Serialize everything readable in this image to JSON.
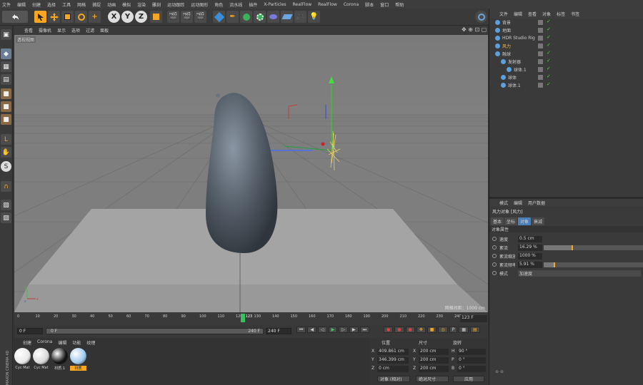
{
  "menubar": [
    "文件",
    "编辑",
    "创建",
    "选择",
    "工具",
    "网格",
    "捕捉",
    "动画",
    "模拟",
    "渲染",
    "雕刻",
    "运动跟踪",
    "运动图形",
    "角色",
    "流水线",
    "插件",
    "X-Particles",
    "RealFlow",
    "RealFlow",
    "Corona",
    "脚本",
    "窗口",
    "帮助"
  ],
  "viewport": {
    "menu": [
      "查看",
      "摄像机",
      "显示",
      "选项",
      "过滤",
      "面板"
    ],
    "label": "透视视图",
    "grid_info": "网格间距：1000 cm"
  },
  "timeline": {
    "ticks": [
      "0",
      "10",
      "20",
      "30",
      "40",
      "50",
      "60",
      "70",
      "80",
      "90",
      "100",
      "110",
      "120",
      "130",
      "140",
      "150",
      "160",
      "170",
      "180",
      "190",
      "200",
      "210",
      "220",
      "230",
      "240"
    ],
    "current_frame": "123",
    "frame_badge": "123 F"
  },
  "transport": {
    "start": "0 F",
    "range_start": "0 F",
    "range_end": "240 F",
    "end": "240 F"
  },
  "materials": {
    "tabs": [
      "创建",
      "Corona",
      "编辑",
      "功能",
      "纹理"
    ],
    "items": [
      {
        "label": "Cyc Mat",
        "color": "#e8e8e8"
      },
      {
        "label": "Cyc Mat",
        "color": "#d8d8d8"
      },
      {
        "label": "材质.1",
        "color": "#111111"
      },
      {
        "label": "材质",
        "color": "#9fc8ef"
      }
    ],
    "logo_text": "MAXON CINEMA 4D"
  },
  "coords": {
    "headers": [
      "位置",
      "尺寸",
      "旋转"
    ],
    "rows": [
      {
        "axis": "X",
        "pos": "409.861 cm",
        "size_axis": "X",
        "size": "200 cm",
        "rot_axis": "H",
        "rot": "90 °"
      },
      {
        "axis": "Y",
        "pos": "346.399 cm",
        "size_axis": "Y",
        "size": "200 cm",
        "rot_axis": "P",
        "rot": "0 °"
      },
      {
        "axis": "Z",
        "pos": "0 cm",
        "size_axis": "Z",
        "size": "200 cm",
        "rot_axis": "B",
        "rot": "0 °"
      }
    ],
    "mode_select": "对象 (相对)",
    "size_select": "绝对尺寸",
    "apply_button": "应用"
  },
  "object_manager": {
    "menu": [
      "文件",
      "编辑",
      "查看",
      "对象",
      "标签",
      "书签"
    ],
    "objects": [
      {
        "name": "背景",
        "indent": 0,
        "color": "#cccccc"
      },
      {
        "name": "地面",
        "indent": 0,
        "color": "#cccccc"
      },
      {
        "name": "HDR Studio Rig",
        "indent": 0,
        "color": "#cccccc"
      },
      {
        "name": "风力",
        "indent": 0,
        "color": "#f0c040"
      },
      {
        "name": "融球",
        "indent": 0,
        "color": "#cccccc"
      },
      {
        "name": "发射器",
        "indent": 1,
        "color": "#cccccc"
      },
      {
        "name": "球体.1",
        "indent": 2,
        "color": "#cccccc"
      },
      {
        "name": "球体",
        "indent": 1,
        "color": "#cccccc"
      },
      {
        "name": "球体.1",
        "indent": 1,
        "color": "#cccccc"
      }
    ]
  },
  "attribute_manager": {
    "menu": [
      "模式",
      "编辑",
      "用户数据"
    ],
    "title": "风力对象 [风力]",
    "tabs": [
      "基本",
      "坐标",
      "对象",
      "衰减"
    ],
    "section": "对象属性",
    "properties": [
      {
        "label": "速度",
        "value": "0.5 cm",
        "slider": null
      },
      {
        "label": "紊流",
        "value": "16.29 %",
        "slider": 0.1629
      },
      {
        "label": "紊流缩放",
        "value": "1000 %",
        "slider": null
      },
      {
        "label": "紊流频率",
        "value": "5.91 %",
        "slider": 0.0591
      },
      {
        "label": "模式",
        "value": "加速度",
        "slider": null
      }
    ]
  },
  "colors": {
    "accent_orange": "#f5a623",
    "active_blue": "#4a7fb8",
    "playhead_green": "#36c060"
  }
}
